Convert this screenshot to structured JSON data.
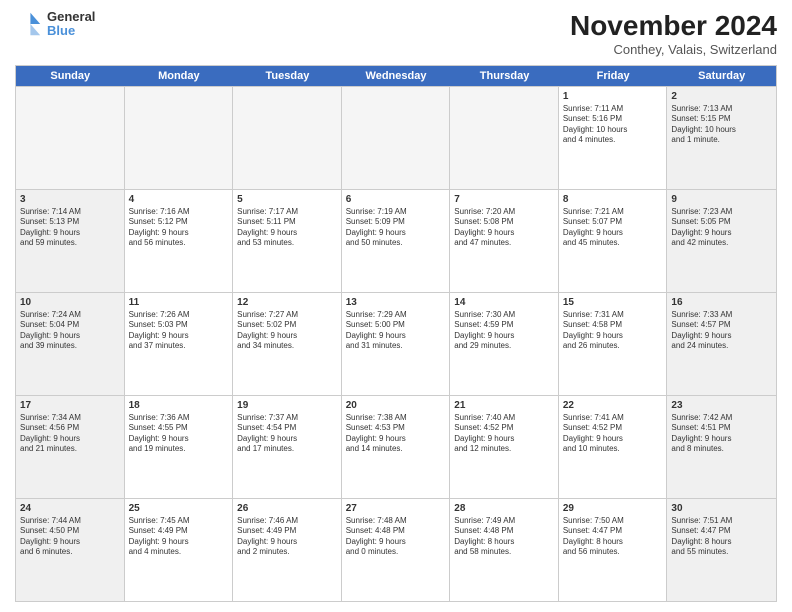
{
  "header": {
    "logo_line1": "General",
    "logo_line2": "Blue",
    "month": "November 2024",
    "location": "Conthey, Valais, Switzerland"
  },
  "weekdays": [
    "Sunday",
    "Monday",
    "Tuesday",
    "Wednesday",
    "Thursday",
    "Friday",
    "Saturday"
  ],
  "rows": [
    [
      {
        "day": "",
        "info": "",
        "type": "empty"
      },
      {
        "day": "",
        "info": "",
        "type": "empty"
      },
      {
        "day": "",
        "info": "",
        "type": "empty"
      },
      {
        "day": "",
        "info": "",
        "type": "empty"
      },
      {
        "day": "",
        "info": "",
        "type": "empty"
      },
      {
        "day": "1",
        "info": "Sunrise: 7:11 AM\nSunset: 5:16 PM\nDaylight: 10 hours\nand 4 minutes.",
        "type": ""
      },
      {
        "day": "2",
        "info": "Sunrise: 7:13 AM\nSunset: 5:15 PM\nDaylight: 10 hours\nand 1 minute.",
        "type": "weekend"
      }
    ],
    [
      {
        "day": "3",
        "info": "Sunrise: 7:14 AM\nSunset: 5:13 PM\nDaylight: 9 hours\nand 59 minutes.",
        "type": "weekend"
      },
      {
        "day": "4",
        "info": "Sunrise: 7:16 AM\nSunset: 5:12 PM\nDaylight: 9 hours\nand 56 minutes.",
        "type": ""
      },
      {
        "day": "5",
        "info": "Sunrise: 7:17 AM\nSunset: 5:11 PM\nDaylight: 9 hours\nand 53 minutes.",
        "type": ""
      },
      {
        "day": "6",
        "info": "Sunrise: 7:19 AM\nSunset: 5:09 PM\nDaylight: 9 hours\nand 50 minutes.",
        "type": ""
      },
      {
        "day": "7",
        "info": "Sunrise: 7:20 AM\nSunset: 5:08 PM\nDaylight: 9 hours\nand 47 minutes.",
        "type": ""
      },
      {
        "day": "8",
        "info": "Sunrise: 7:21 AM\nSunset: 5:07 PM\nDaylight: 9 hours\nand 45 minutes.",
        "type": ""
      },
      {
        "day": "9",
        "info": "Sunrise: 7:23 AM\nSunset: 5:05 PM\nDaylight: 9 hours\nand 42 minutes.",
        "type": "weekend"
      }
    ],
    [
      {
        "day": "10",
        "info": "Sunrise: 7:24 AM\nSunset: 5:04 PM\nDaylight: 9 hours\nand 39 minutes.",
        "type": "weekend"
      },
      {
        "day": "11",
        "info": "Sunrise: 7:26 AM\nSunset: 5:03 PM\nDaylight: 9 hours\nand 37 minutes.",
        "type": ""
      },
      {
        "day": "12",
        "info": "Sunrise: 7:27 AM\nSunset: 5:02 PM\nDaylight: 9 hours\nand 34 minutes.",
        "type": ""
      },
      {
        "day": "13",
        "info": "Sunrise: 7:29 AM\nSunset: 5:00 PM\nDaylight: 9 hours\nand 31 minutes.",
        "type": ""
      },
      {
        "day": "14",
        "info": "Sunrise: 7:30 AM\nSunset: 4:59 PM\nDaylight: 9 hours\nand 29 minutes.",
        "type": ""
      },
      {
        "day": "15",
        "info": "Sunrise: 7:31 AM\nSunset: 4:58 PM\nDaylight: 9 hours\nand 26 minutes.",
        "type": ""
      },
      {
        "day": "16",
        "info": "Sunrise: 7:33 AM\nSunset: 4:57 PM\nDaylight: 9 hours\nand 24 minutes.",
        "type": "weekend"
      }
    ],
    [
      {
        "day": "17",
        "info": "Sunrise: 7:34 AM\nSunset: 4:56 PM\nDaylight: 9 hours\nand 21 minutes.",
        "type": "weekend"
      },
      {
        "day": "18",
        "info": "Sunrise: 7:36 AM\nSunset: 4:55 PM\nDaylight: 9 hours\nand 19 minutes.",
        "type": ""
      },
      {
        "day": "19",
        "info": "Sunrise: 7:37 AM\nSunset: 4:54 PM\nDaylight: 9 hours\nand 17 minutes.",
        "type": ""
      },
      {
        "day": "20",
        "info": "Sunrise: 7:38 AM\nSunset: 4:53 PM\nDaylight: 9 hours\nand 14 minutes.",
        "type": ""
      },
      {
        "day": "21",
        "info": "Sunrise: 7:40 AM\nSunset: 4:52 PM\nDaylight: 9 hours\nand 12 minutes.",
        "type": ""
      },
      {
        "day": "22",
        "info": "Sunrise: 7:41 AM\nSunset: 4:52 PM\nDaylight: 9 hours\nand 10 minutes.",
        "type": ""
      },
      {
        "day": "23",
        "info": "Sunrise: 7:42 AM\nSunset: 4:51 PM\nDaylight: 9 hours\nand 8 minutes.",
        "type": "weekend"
      }
    ],
    [
      {
        "day": "24",
        "info": "Sunrise: 7:44 AM\nSunset: 4:50 PM\nDaylight: 9 hours\nand 6 minutes.",
        "type": "weekend"
      },
      {
        "day": "25",
        "info": "Sunrise: 7:45 AM\nSunset: 4:49 PM\nDaylight: 9 hours\nand 4 minutes.",
        "type": ""
      },
      {
        "day": "26",
        "info": "Sunrise: 7:46 AM\nSunset: 4:49 PM\nDaylight: 9 hours\nand 2 minutes.",
        "type": ""
      },
      {
        "day": "27",
        "info": "Sunrise: 7:48 AM\nSunset: 4:48 PM\nDaylight: 9 hours\nand 0 minutes.",
        "type": ""
      },
      {
        "day": "28",
        "info": "Sunrise: 7:49 AM\nSunset: 4:48 PM\nDaylight: 8 hours\nand 58 minutes.",
        "type": ""
      },
      {
        "day": "29",
        "info": "Sunrise: 7:50 AM\nSunset: 4:47 PM\nDaylight: 8 hours\nand 56 minutes.",
        "type": ""
      },
      {
        "day": "30",
        "info": "Sunrise: 7:51 AM\nSunset: 4:47 PM\nDaylight: 8 hours\nand 55 minutes.",
        "type": "weekend"
      }
    ]
  ]
}
